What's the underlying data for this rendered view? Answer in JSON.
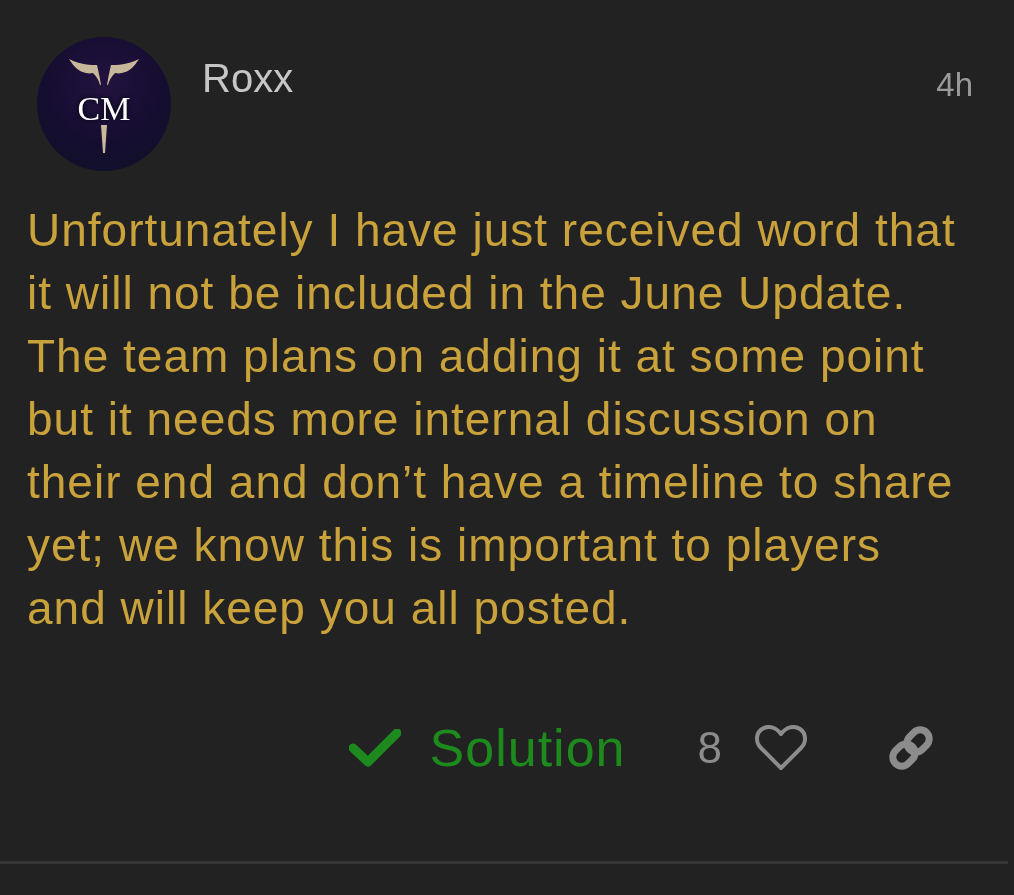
{
  "post": {
    "author": {
      "name": "Roxx",
      "avatar": {
        "initials": "CM"
      }
    },
    "time": "4h",
    "body": {
      "lines": [
        "Unfortunately I have just received word that",
        "it will not be included in the June Update.",
        "The team plans on adding it at some point",
        "but it needs more internal discussion on",
        "their end and don’t have a timeline to share",
        "yet; we know this is important to players",
        "and will keep you all posted."
      ]
    },
    "actions": {
      "solution": {
        "label": "Solution"
      },
      "likes": {
        "count": "8",
        "liked": false
      }
    }
  }
}
